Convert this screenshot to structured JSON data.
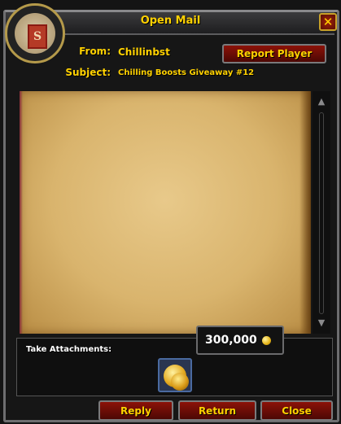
{
  "window": {
    "title": "Open Mail",
    "close_icon": "close-icon"
  },
  "mail": {
    "from_label": "From:",
    "from_value": "Chillinbst",
    "subject_label": "Subject:",
    "subject_value": "Chilling Boosts Giveaway #12",
    "report_button": "Report Player"
  },
  "attachments": {
    "label": "Take Attachments:",
    "gold_amount": "300,000",
    "gold_icon": "gold-coin-icon",
    "item_icon": "gold-coins-item-icon"
  },
  "footer": {
    "reply": "Reply",
    "return": "Return",
    "close": "Close"
  },
  "colors": {
    "title_gold": "#ffd100",
    "button_red": "#8c1208",
    "parchment": "#d9b46d"
  }
}
